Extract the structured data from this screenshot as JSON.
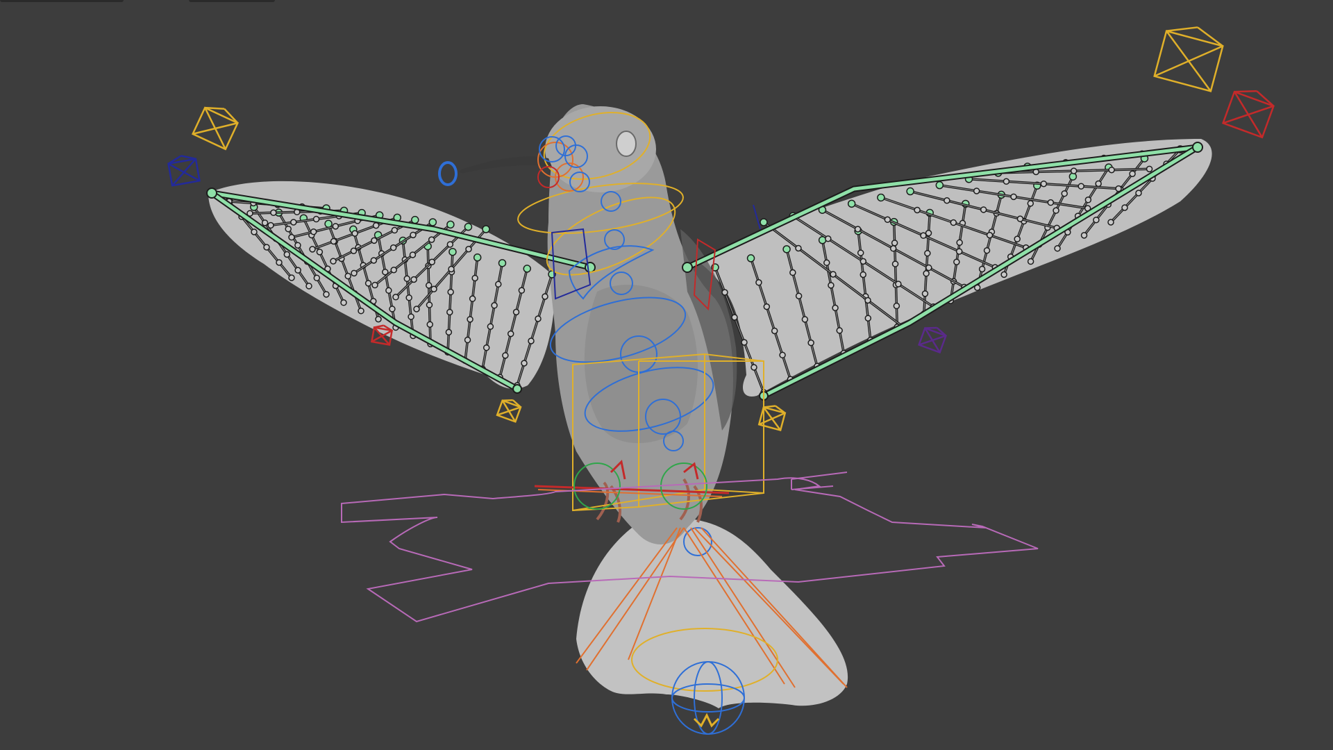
{
  "viewport": {
    "background": "#3d3d3d",
    "mesh_color": "#b8b8b8",
    "bone_color": "#1c1c1c",
    "bone_selected_color": "#8fe0a8",
    "control_colors": {
      "yellow": "#e0b02a",
      "blue": "#2f6fd6",
      "red": "#c42a2a",
      "orange": "#e07030",
      "magenta": "#b86ab8",
      "green": "#2fa64a",
      "navy": "#232a9a"
    }
  },
  "icons": {
    "empty_marker": "octahedron-empty-icon",
    "root_control": "root-arrow-control-icon"
  }
}
